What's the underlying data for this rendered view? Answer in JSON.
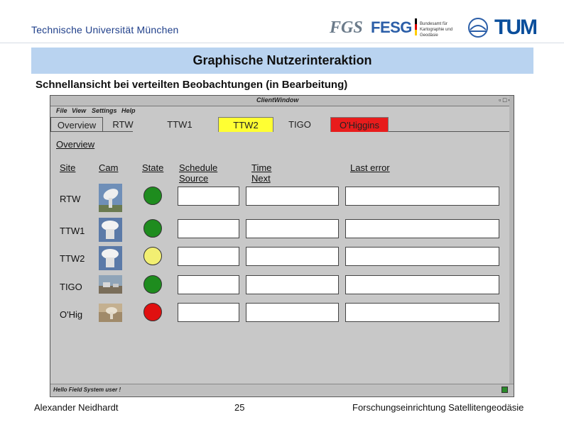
{
  "header": {
    "university": "Technische Universität München",
    "logos": {
      "fgs": "FGS",
      "fesg": "FESG",
      "bkg": "Bundesamt für Kartographie und Geodäsie",
      "tum": "TUM"
    }
  },
  "slide": {
    "title": "Graphische Nutzerinteraktion",
    "subtitle": "Schnellansicht bei verteilten Beobachtungen (in Bearbeitung)"
  },
  "window": {
    "title": "ClientWindow",
    "menu": [
      "File",
      "View",
      "Settings",
      "Help"
    ],
    "tabs": [
      {
        "label": "Overview",
        "color": "#c8c8c8"
      },
      {
        "label": "RTW",
        "color": "#c8c8c8"
      },
      {
        "label": "TTW1",
        "color": "#c8c8c8"
      },
      {
        "label": "TTW2",
        "color": "#ffff33"
      },
      {
        "label": "TIGO",
        "color": "#c8c8c8"
      },
      {
        "label": "O'Higgins",
        "color": "#e81c1c"
      }
    ],
    "section_title": "Overview",
    "columns": {
      "site": "Site",
      "cam": "Cam",
      "state": "State",
      "schedule_source": "Schedule Source",
      "time_next": "Time Next",
      "last_error": "Last error"
    },
    "rows": [
      {
        "site": "RTW",
        "state_color": "#1e8c1e",
        "cam": "radio-telescope-image"
      },
      {
        "site": "TTW1",
        "state_color": "#1e8c1e",
        "cam": "radio-telescope-image"
      },
      {
        "site": "TTW2",
        "state_color": "#f2ef72",
        "cam": "radio-telescope-image"
      },
      {
        "site": "TIGO",
        "state_color": "#1e8c1e",
        "cam": "station-photo"
      },
      {
        "site": "O'Hig",
        "state_color": "#e01010",
        "cam": "station-photo"
      }
    ],
    "status_message": "Hello Field System user !"
  },
  "footer": {
    "author": "Alexander Neidhardt",
    "page": "25",
    "institute": "Forschungseinrichtung Satellitengeodäsie"
  }
}
